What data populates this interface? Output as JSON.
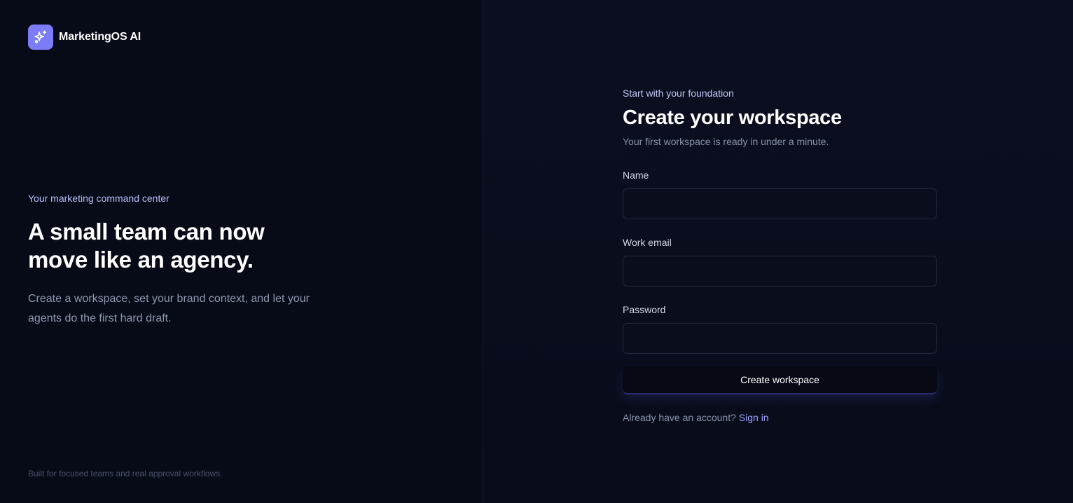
{
  "brand": {
    "name": "MarketingOS AI",
    "icon": "sparkles-icon",
    "accent": "#7b7cf6"
  },
  "hero": {
    "eyebrow": "Your marketing command center",
    "title_line1": "A small team can now",
    "title_line2": "move like an agency.",
    "description": "Create a workspace, set your brand context, and let your agents do the first hard draft."
  },
  "footnote": "Built for focused teams and real approval workflows.",
  "form": {
    "eyebrow": "Start with your foundation",
    "title": "Create your workspace",
    "subtitle": "Your first workspace is ready in under a minute.",
    "fields": [
      {
        "label": "Name",
        "value": "",
        "type": "text"
      },
      {
        "label": "Work email",
        "value": "",
        "type": "email"
      },
      {
        "label": "Password",
        "value": "",
        "type": "password"
      }
    ],
    "submit_label": "Create workspace",
    "signin_prompt": "Already have an account?",
    "signin_link": "Sign in"
  }
}
